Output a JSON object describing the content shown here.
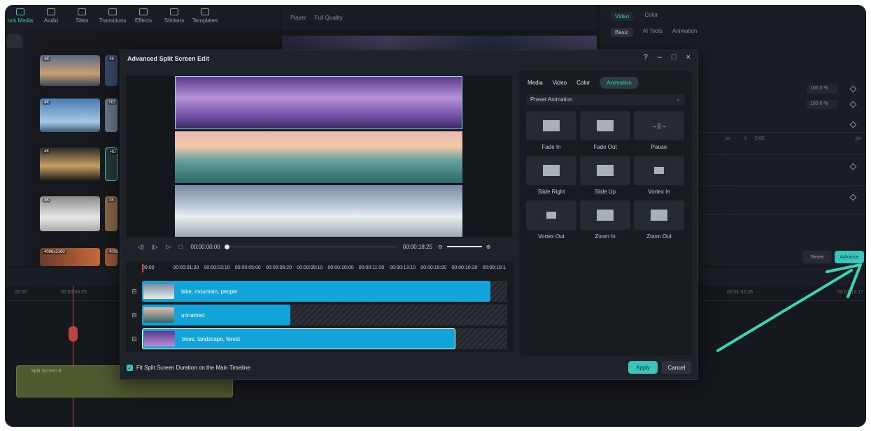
{
  "top_tools": [
    {
      "label": "ock Media",
      "icon": "stock-media-icon",
      "active": true
    },
    {
      "label": "Audio",
      "icon": "music-note-icon"
    },
    {
      "label": "Titles",
      "icon": "text-icon"
    },
    {
      "label": "Transitions",
      "icon": "transition-icon"
    },
    {
      "label": "Effects",
      "icon": "effects-icon"
    },
    {
      "label": "Stickers",
      "icon": "stickers-icon"
    },
    {
      "label": "Templates",
      "icon": "templates-icon"
    }
  ],
  "player": {
    "label": "Player",
    "quality": "Full Quality"
  },
  "right_panel": {
    "tabs": [
      "Video",
      "Color"
    ],
    "subtabs": [
      "Basic",
      "AI Tools",
      "Animation"
    ],
    "value1": "100.0",
    "unit1": "%",
    "value2": "100.0",
    "unit2": "%",
    "px_label": "px",
    "y_label": "Y",
    "y_value": "0.00",
    "px_label2": "px",
    "reset": "Reset",
    "advance": "Advance"
  },
  "main_timeline": {
    "times": [
      "00:00",
      "00:00:04:25",
      "00:01:02:26",
      "00:01:12:17"
    ],
    "split_clip_label": "Split Screen 6"
  },
  "thumb_badges": [
    "4K",
    "4K",
    "HD",
    "4K",
    "HD",
    "4K",
    "4K",
    "4096x2160",
    "4096"
  ],
  "dialog": {
    "title": "Advanced Split Screen Edit",
    "player": {
      "current": "00:00:00:00",
      "duration": "00:00:18:25"
    },
    "ruler": [
      "00:00",
      "00:00:01:20",
      "00:00:03:10",
      "00:00:05:00",
      "00:00:06:20",
      "00:00:08:10",
      "00:00:10:00",
      "00:00:11:20",
      "00:00:13:10",
      "00:00:15:00",
      "00:00:16:20",
      "00:00:18:1"
    ],
    "tracks": [
      {
        "label": "lake, mountain, people",
        "fill": 0.94
      },
      {
        "label": "unnamed",
        "fill": 0.4
      },
      {
        "label": "trees, landscape, forest",
        "fill": 0.85
      }
    ],
    "anim_tabs": [
      "Media",
      "Video",
      "Color",
      "Animation"
    ],
    "active_anim_tab": "Animation",
    "preset": "Preset Animation",
    "animations": [
      "Fade In",
      "Fade Out",
      "Pause",
      "Slide Right",
      "Slide Up",
      "Vortex In",
      "Vortex Out",
      "Zoom In",
      "Zoom Out"
    ],
    "fit_label": "Fit Split Screen Duration on the Main Timeline",
    "apply": "Apply",
    "cancel": "Cancel"
  },
  "accent_color": "#39c5b9",
  "clip_color": "#12a4d9"
}
